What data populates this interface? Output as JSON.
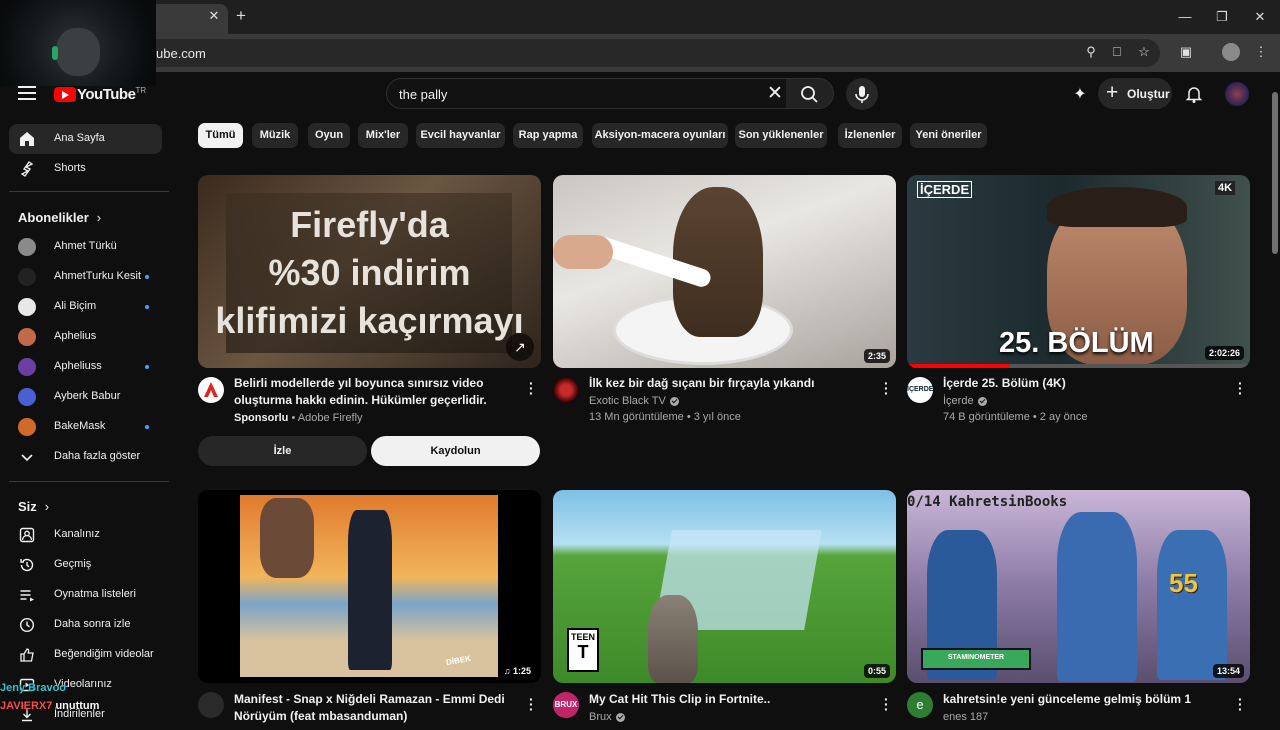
{
  "browser": {
    "url": "ube.com",
    "tab_close": "✕",
    "new_tab": "+"
  },
  "header": {
    "logo_text": "YouTube",
    "logo_sup": "TR",
    "search_value": "the pally",
    "create_label": "Oluştur"
  },
  "sidebar": {
    "main": [
      {
        "label": "Ana Sayfa",
        "icon": "home-icon",
        "active": true
      },
      {
        "label": "Shorts",
        "icon": "shorts-icon"
      }
    ],
    "subs_title": "Abonelikler",
    "subscriptions": [
      {
        "label": "Ahmet Türkü",
        "dot": false,
        "color": "#8a8a8a"
      },
      {
        "label": "AhmetTurku Kesit",
        "dot": true,
        "color": "#222222"
      },
      {
        "label": "Ali Biçim",
        "dot": true,
        "color": "#e8e8e8"
      },
      {
        "label": "Aphelius",
        "dot": false,
        "color": "#c06a4a"
      },
      {
        "label": "Apheliuss",
        "dot": true,
        "color": "#6a3fa0"
      },
      {
        "label": "Ayberk Babur",
        "dot": false,
        "color": "#4a5fd0"
      },
      {
        "label": "BakeMask",
        "dot": true,
        "color": "#d06a2a"
      }
    ],
    "show_more": "Daha fazla göster",
    "you_title": "Siz",
    "you_items": [
      {
        "label": "Kanalınız",
        "icon": "channel-icon"
      },
      {
        "label": "Geçmiş",
        "icon": "history-icon"
      },
      {
        "label": "Oynatma listeleri",
        "icon": "playlists-icon"
      },
      {
        "label": "Daha sonra izle",
        "icon": "watch-later-icon"
      },
      {
        "label": "Beğendiğim videolar",
        "icon": "liked-icon"
      },
      {
        "label": "Videolarınız",
        "icon": "your-videos-icon"
      },
      {
        "label": "İndirilenler",
        "icon": "downloads-icon"
      }
    ]
  },
  "chips": [
    "Tümü",
    "Müzik",
    "Oyun",
    "Mix'ler",
    "Evcil hayvanlar",
    "Rap yapma",
    "Aksiyon-macera oyunları",
    "Son yüklenenler",
    "İzlenenler",
    "Yeni öneriler"
  ],
  "ad": {
    "thumb_text": [
      "Firefly'da",
      "%30 indirim",
      "klifimizi kaçırmayı"
    ],
    "title_line1": "Belirli modellerde yıl boyunca sınırsız video",
    "title_line2": "oluşturma hakkı edinin. Hükümler geçerlidir.",
    "sponsored": "Sponsorlu",
    "advertiser": "Adobe Firefly",
    "watch_button": "İzle",
    "signup_button": "Kaydolun"
  },
  "videos": [
    {
      "title": "İlk kez bir dağ sıçanı bir fırçayla yıkandı",
      "channel": "Exotic Black TV",
      "verified": true,
      "meta": "13 Mn görüntüleme • 3 yıl önce",
      "duration": "2:35"
    },
    {
      "title": "İçerde 25. Bölüm (4K)",
      "channel": "İçerde",
      "verified": true,
      "meta": "74 B görüntüleme • 2 ay önce",
      "duration": "2:02:26",
      "thumb_tag": "İÇERDE",
      "thumb_badge": "4K",
      "thumb_caption": "25. BÖLÜM"
    },
    {
      "title": "Manifest - Snap x Niğdeli Ramazan - Emmi Dedi",
      "title2": "Nörüyüm (feat mbasanduman)",
      "channel": "",
      "meta": "",
      "duration": "1:25",
      "thumb_caption": "DİBEK"
    },
    {
      "title": "My Cat Hit This Clip in Fortnite..",
      "channel": "Brux",
      "verified": true,
      "meta": "",
      "duration": "0:55",
      "thumb_tag": "TEEN"
    },
    {
      "title": "kahretsin!e yeni günceleme gelmiş bölüm 1",
      "channel": "enes 187",
      "verified": false,
      "meta": "",
      "duration": "13:54",
      "thumb_tag": "0/14 KahretsinBooks",
      "thumb_badge": "55",
      "thumb_caption": "STAMINOMETER"
    }
  ],
  "overlay_chat": [
    {
      "user": "Jeny Bravoo",
      "text": "",
      "color": "#2ec4d6"
    },
    {
      "user": "JAVIERX7",
      "text": "unuttum",
      "color": "#ff4c4c"
    }
  ],
  "colors": {
    "accent": "#ff0000",
    "dot": "#3ea6ff",
    "bg": "#0f0f0f"
  }
}
